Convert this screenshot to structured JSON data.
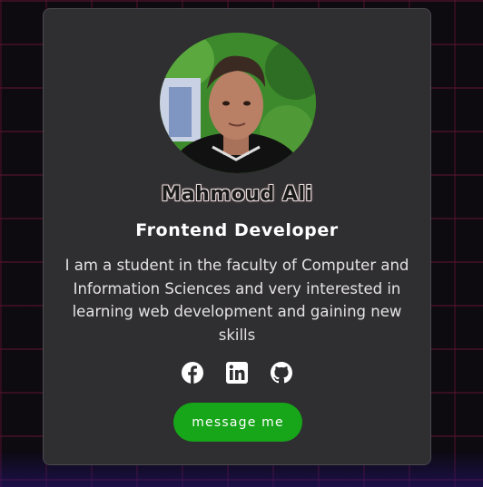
{
  "profile": {
    "name": "Mahmoud Ali",
    "role": "Frontend Developer",
    "bio": "I am a student in the faculty of Computer and Information Sciences and very interested in learning web development and gaining new skills"
  },
  "socials": [
    {
      "icon": "facebook-icon"
    },
    {
      "icon": "linkedin-icon"
    },
    {
      "icon": "github-icon"
    }
  ],
  "actions": {
    "message_label": "message me"
  },
  "colors": {
    "card_background": "#2f2e30",
    "page_background": "#0d0a10",
    "button": "#17a51a"
  }
}
